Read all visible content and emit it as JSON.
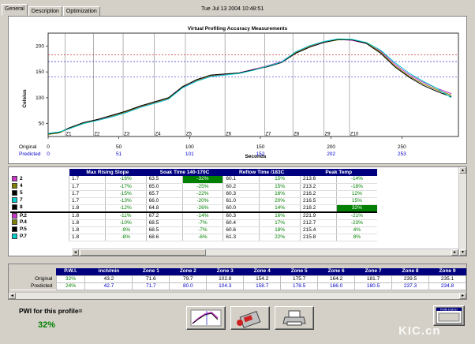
{
  "tabs": [
    {
      "label": "General",
      "active": true
    },
    {
      "label": "Description",
      "active": false
    },
    {
      "label": "Optimization",
      "active": false
    }
  ],
  "datetime": "Tue Jul 13 2004 10:48:51",
  "chart_data": {
    "type": "line",
    "title": "Virtual Profiling Accuracy Measurements",
    "ylabel": "Celsius",
    "xlabel": "Seconds",
    "ylim": [
      25,
      225
    ],
    "xlim": [
      0,
      290
    ],
    "yticks": [
      "50",
      "100",
      "150",
      "200"
    ],
    "ytick_values": [
      50,
      100,
      150,
      200
    ],
    "xticks": [
      "0",
      "50",
      "100",
      "150",
      "200",
      "250"
    ],
    "xtick_values": [
      0,
      50,
      100,
      150,
      200,
      250
    ],
    "x_row_labels": {
      "original": "Original",
      "predicted": "Predicted"
    },
    "predicted_ticks": [
      "0",
      "51",
      "101",
      "152",
      "202",
      "253"
    ],
    "zones": [
      {
        "label": "Z1",
        "x": 12
      },
      {
        "label": "Z2",
        "x": 32
      },
      {
        "label": "Z3",
        "x": 53
      },
      {
        "label": "Z4",
        "x": 75
      },
      {
        "label": "Z5",
        "x": 97
      },
      {
        "label": "Z6",
        "x": 125
      },
      {
        "label": "Z7",
        "x": 153
      },
      {
        "label": "Z8",
        "x": 173
      },
      {
        "label": "Z9",
        "x": 195
      },
      {
        "label": "Z10",
        "x": 213
      }
    ],
    "ref_lines": [
      {
        "y": 183,
        "color": "#cc3333"
      },
      {
        "y": 170,
        "color": "#3333cc"
      },
      {
        "y": 140,
        "color": "#3333cc"
      }
    ],
    "series": [
      {
        "color": "#cc33cc",
        "points": [
          [
            0,
            30
          ],
          [
            8,
            33
          ],
          [
            15,
            40
          ],
          [
            25,
            50
          ],
          [
            35,
            57
          ],
          [
            45,
            64
          ],
          [
            55,
            72
          ],
          [
            65,
            82
          ],
          [
            75,
            90
          ],
          [
            85,
            98
          ],
          [
            95,
            120
          ],
          [
            105,
            133
          ],
          [
            115,
            142
          ],
          [
            125,
            145
          ],
          [
            135,
            148
          ],
          [
            145,
            155
          ],
          [
            155,
            162
          ],
          [
            165,
            170
          ],
          [
            175,
            188
          ],
          [
            185,
            200
          ],
          [
            195,
            208
          ],
          [
            205,
            213
          ],
          [
            215,
            211
          ],
          [
            225,
            205
          ],
          [
            235,
            190
          ],
          [
            245,
            165
          ],
          [
            255,
            145
          ],
          [
            265,
            130
          ],
          [
            275,
            118
          ],
          [
            285,
            108
          ]
        ]
      },
      {
        "color": "#808000",
        "points": [
          [
            0,
            29
          ],
          [
            8,
            32
          ],
          [
            15,
            41
          ],
          [
            25,
            51
          ],
          [
            35,
            58
          ],
          [
            45,
            65
          ],
          [
            55,
            73
          ],
          [
            65,
            83
          ],
          [
            75,
            91
          ],
          [
            85,
            99
          ],
          [
            95,
            122
          ],
          [
            105,
            134
          ],
          [
            115,
            143
          ],
          [
            125,
            146
          ],
          [
            135,
            147
          ],
          [
            145,
            154
          ],
          [
            155,
            161
          ],
          [
            165,
            169
          ],
          [
            175,
            187
          ],
          [
            185,
            199
          ],
          [
            195,
            207
          ],
          [
            205,
            212
          ],
          [
            215,
            212
          ],
          [
            225,
            206
          ],
          [
            235,
            188
          ],
          [
            245,
            162
          ],
          [
            255,
            142
          ],
          [
            265,
            127
          ],
          [
            275,
            115
          ],
          [
            285,
            105
          ]
        ]
      },
      {
        "color": "#000000",
        "points": [
          [
            0,
            30
          ],
          [
            8,
            33
          ],
          [
            15,
            42
          ],
          [
            25,
            52
          ],
          [
            35,
            58
          ],
          [
            45,
            66
          ],
          [
            55,
            74
          ],
          [
            65,
            84
          ],
          [
            75,
            92
          ],
          [
            85,
            100
          ],
          [
            95,
            121
          ],
          [
            105,
            135
          ],
          [
            115,
            144
          ],
          [
            125,
            146
          ],
          [
            135,
            148
          ],
          [
            145,
            154
          ],
          [
            155,
            160
          ],
          [
            165,
            168
          ],
          [
            175,
            186
          ],
          [
            185,
            198
          ],
          [
            195,
            207
          ],
          [
            205,
            213
          ],
          [
            215,
            212
          ],
          [
            225,
            205
          ],
          [
            235,
            186
          ],
          [
            245,
            160
          ],
          [
            255,
            140
          ],
          [
            265,
            124
          ],
          [
            275,
            112
          ],
          [
            285,
            102
          ]
        ]
      },
      {
        "color": "#00cccc",
        "points": [
          [
            0,
            31
          ],
          [
            8,
            34
          ],
          [
            15,
            40
          ],
          [
            25,
            50
          ],
          [
            35,
            56
          ],
          [
            45,
            63
          ],
          [
            55,
            71
          ],
          [
            65,
            81
          ],
          [
            75,
            89
          ],
          [
            85,
            97
          ],
          [
            95,
            119
          ],
          [
            105,
            132
          ],
          [
            115,
            141
          ],
          [
            125,
            144
          ],
          [
            135,
            147
          ],
          [
            145,
            153
          ],
          [
            155,
            161
          ],
          [
            165,
            169
          ],
          [
            175,
            189
          ],
          [
            185,
            201
          ],
          [
            195,
            209
          ],
          [
            205,
            214
          ],
          [
            215,
            213
          ],
          [
            225,
            207
          ],
          [
            235,
            192
          ],
          [
            245,
            168
          ],
          [
            255,
            148
          ],
          [
            265,
            132
          ],
          [
            275,
            118
          ],
          [
            285,
            100
          ]
        ]
      }
    ]
  },
  "grid": {
    "headers": [
      "Max Rising Slope",
      "Soak Time 140-170C",
      "Reflow Time /183C",
      "Peak Temp"
    ],
    "rows": [
      {
        "name": "2",
        "color": "#cc33cc",
        "c1": "1.7",
        "c2": "-16%",
        "c3": "63.5",
        "c4": "-32%",
        "c5": "60.1",
        "c6": "15%",
        "c7": "213.6",
        "c8": "-14%",
        "hl4": true,
        "hl8": false
      },
      {
        "name": "4",
        "color": "#808000",
        "c1": "1.7",
        "c2": "-17%",
        "c3": "65.0",
        "c4": "-25%",
        "c5": "60.2",
        "c6": "15%",
        "c7": "213.2",
        "c8": "-18%",
        "hl4": false,
        "hl8": false
      },
      {
        "name": "5",
        "color": "#000000",
        "c1": "1.7",
        "c2": "-15%",
        "c3": "65.7",
        "c4": "-22%",
        "c5": "60.3",
        "c6": "16%",
        "c7": "216.2",
        "c8": "12%",
        "hl4": false,
        "hl8": false
      },
      {
        "name": "7",
        "color": "#00cccc",
        "c1": "1.7",
        "c2": "-13%",
        "c3": "66.0",
        "c4": "-20%",
        "c5": "61.0",
        "c6": "20%",
        "c7": "216.5",
        "c8": "15%",
        "hl4": false,
        "hl8": false
      },
      {
        "name": "8",
        "color": "#000000",
        "c1": "1.8",
        "c2": "-12%",
        "c3": "64.8",
        "c4": "-26%",
        "c5": "60.0",
        "c6": "14%",
        "c7": "218.2",
        "c8": "32%",
        "hl4": false,
        "hl8": true
      },
      {
        "name": "P.2",
        "color": "#cc33cc",
        "c1": "1.8",
        "c2": "-11%",
        "c3": "67.2",
        "c4": "-14%",
        "c5": "60.3",
        "c6": "16%",
        "c7": "221.9",
        "c8": "-21%",
        "hl4": false,
        "hl8": false
      },
      {
        "name": "P.4",
        "color": "#808000",
        "c1": "1.8",
        "c2": "-10%",
        "c3": "68.5",
        "c4": "-7%",
        "c5": "60.4",
        "c6": "17%",
        "c7": "212.7",
        "c8": "-23%",
        "hl4": false,
        "hl8": false
      },
      {
        "name": "P.5",
        "color": "#000000",
        "c1": "1.8",
        "c2": "-9%",
        "c3": "68.5",
        "c4": "-7%",
        "c5": "60.6",
        "c6": "18%",
        "c7": "215.4",
        "c8": "4%",
        "hl4": false,
        "hl8": false
      },
      {
        "name": "P.7",
        "color": "#00cccc",
        "c1": "1.8",
        "c2": "-8%",
        "c3": "68.6",
        "c4": "-6%",
        "c5": "61.3",
        "c6": "22%",
        "c7": "215.8",
        "c8": "8%",
        "hl4": false,
        "hl8": false
      }
    ]
  },
  "summary": {
    "headers": [
      "P.W.I.",
      "inch/min",
      "Zone 1",
      "Zone 2",
      "Zone 3",
      "Zone 4",
      "Zone 5",
      "Zone 6",
      "Zone 7",
      "Zone 8",
      "Zone 9"
    ],
    "rows": [
      {
        "label": "Original",
        "values": [
          "32%",
          "43.2",
          "71.6",
          "79.7",
          "102.8",
          "154.2",
          "175.7",
          "164.2",
          "181.7",
          "239.5",
          "235.1"
        ],
        "color": "#000000"
      },
      {
        "label": "Predicted",
        "values": [
          "24%",
          "42.7",
          "71.7",
          "80.0",
          "104.3",
          "158.7",
          "178.5",
          "166.0",
          "180.5",
          "237.3",
          "234.8"
        ],
        "color": "#0000cc"
      }
    ]
  },
  "pwi": {
    "label": "PWI for this profile=",
    "value": "32%"
  },
  "toolbar": {
    "profile_explorer_label": "Profile Explorer"
  },
  "watermark": "KIC.cn"
}
